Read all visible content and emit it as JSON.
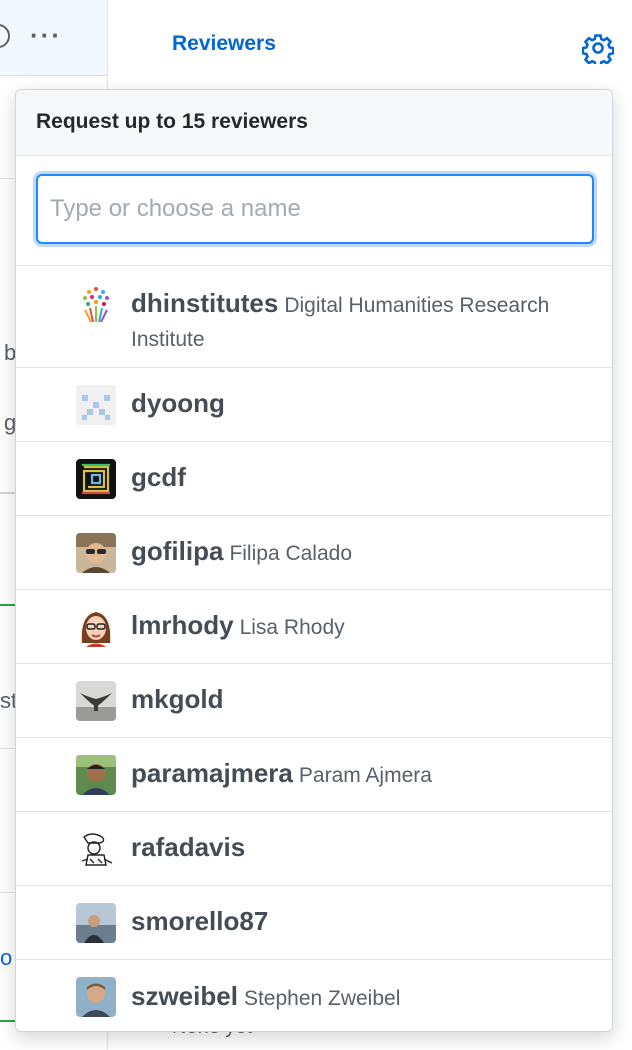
{
  "sidebar": {
    "title": "Reviewers",
    "behind_text": "None yet"
  },
  "left_fragments": [
    "b",
    "g",
    "st",
    "o"
  ],
  "popover": {
    "header": "Request up to 15 reviewers",
    "filter_placeholder": "Type or choose a name",
    "filter_value": "",
    "suggestions": [
      {
        "login": "dhinstitutes",
        "name": "Digital Humanities Research Institute",
        "avatar": "colorful-tree-avatar"
      },
      {
        "login": "dyoong",
        "name": "",
        "avatar": "identicon-avatar"
      },
      {
        "login": "gcdf",
        "name": "",
        "avatar": "dark-pattern-avatar"
      },
      {
        "login": "gofilipa",
        "name": "Filipa Calado",
        "avatar": "photo-avatar"
      },
      {
        "login": "lmrhody",
        "name": "Lisa Rhody",
        "avatar": "cartoon-avatar"
      },
      {
        "login": "mkgold",
        "name": "",
        "avatar": "whale-tail-avatar"
      },
      {
        "login": "paramajmera",
        "name": "Param Ajmera",
        "avatar": "photo-avatar"
      },
      {
        "login": "rafadavis",
        "name": "",
        "avatar": "sketch-avatar"
      },
      {
        "login": "smorello87",
        "name": "",
        "avatar": "photo-avatar"
      },
      {
        "login": "szweibel",
        "name": "Stephen Zweibel",
        "avatar": "photo-avatar"
      }
    ]
  }
}
